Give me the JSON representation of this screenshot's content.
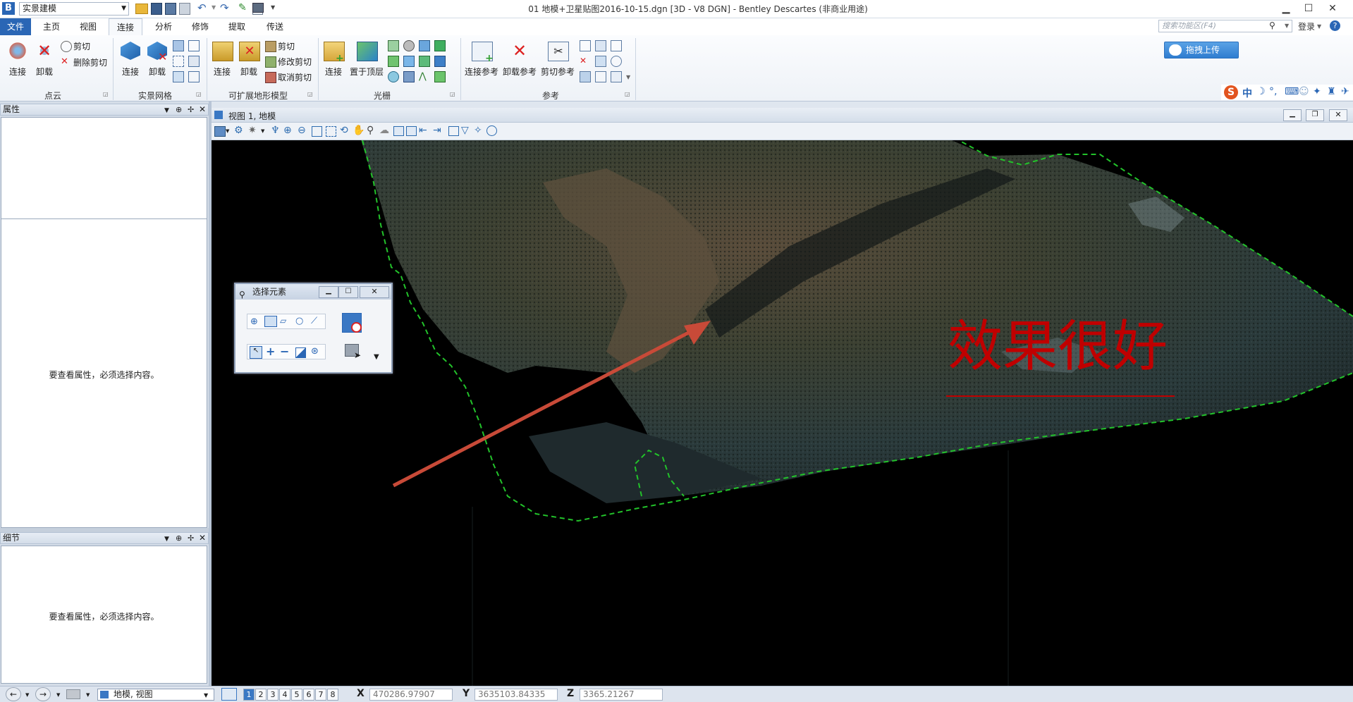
{
  "app": {
    "workspace": "实景建模",
    "title": "01 地模+卫星贴图2016-10-15.dgn [3D - V8 DGN] - Bentley Descartes (非商业用途)"
  },
  "tabs": [
    "文件",
    "主页",
    "视图",
    "连接",
    "分析",
    "修饰",
    "提取",
    "传送"
  ],
  "search": {
    "placeholder": "搜索功能区(F4)"
  },
  "login": "登录",
  "ribbon": {
    "pointcloud": {
      "connect": "连接",
      "unload": "卸载",
      "clip": "剪切",
      "delete_clip": "删除剪切",
      "label": "点云"
    },
    "mesh": {
      "connect": "连接",
      "unload": "卸载",
      "label": "实景网格"
    },
    "terrain": {
      "connect": "连接",
      "unload": "卸载",
      "clip": "剪切",
      "modify_clip": "修改剪切",
      "cancel_clip": "取消剪切",
      "label": "可扩展地形模型"
    },
    "raster": {
      "connect": "连接",
      "bring_top": "置于顶层",
      "label": "光栅"
    },
    "reference": {
      "connect_ref": "连接参考",
      "unload_ref": "卸载参考",
      "clip_ref": "剪切参考",
      "label": "参考"
    }
  },
  "upload_button": "拖拽上传",
  "ime": {
    "lang": "中"
  },
  "panels": {
    "properties": {
      "title": "属性",
      "message": "要查看属性，必须选择内容。"
    },
    "details": {
      "title": "细节",
      "message": "要查看属性，必须选择内容。"
    }
  },
  "view": {
    "title": "视图 1, 地模"
  },
  "select_dialog": {
    "title": "选择元素"
  },
  "annotation": {
    "text": "效果很好"
  },
  "status": {
    "view_select": "地模, 视图",
    "views": [
      "1",
      "2",
      "3",
      "4",
      "5",
      "6",
      "7",
      "8"
    ],
    "x_label": "X",
    "x_value": "470286.97907",
    "y_label": "Y",
    "y_value": "3635103.84335",
    "z_label": "Z",
    "z_value": "3365.21267"
  },
  "colors": {
    "accent": "#2a66b5",
    "annotation": "#c00000",
    "boundary": "#22c22a",
    "arrow": "#c84a38"
  }
}
